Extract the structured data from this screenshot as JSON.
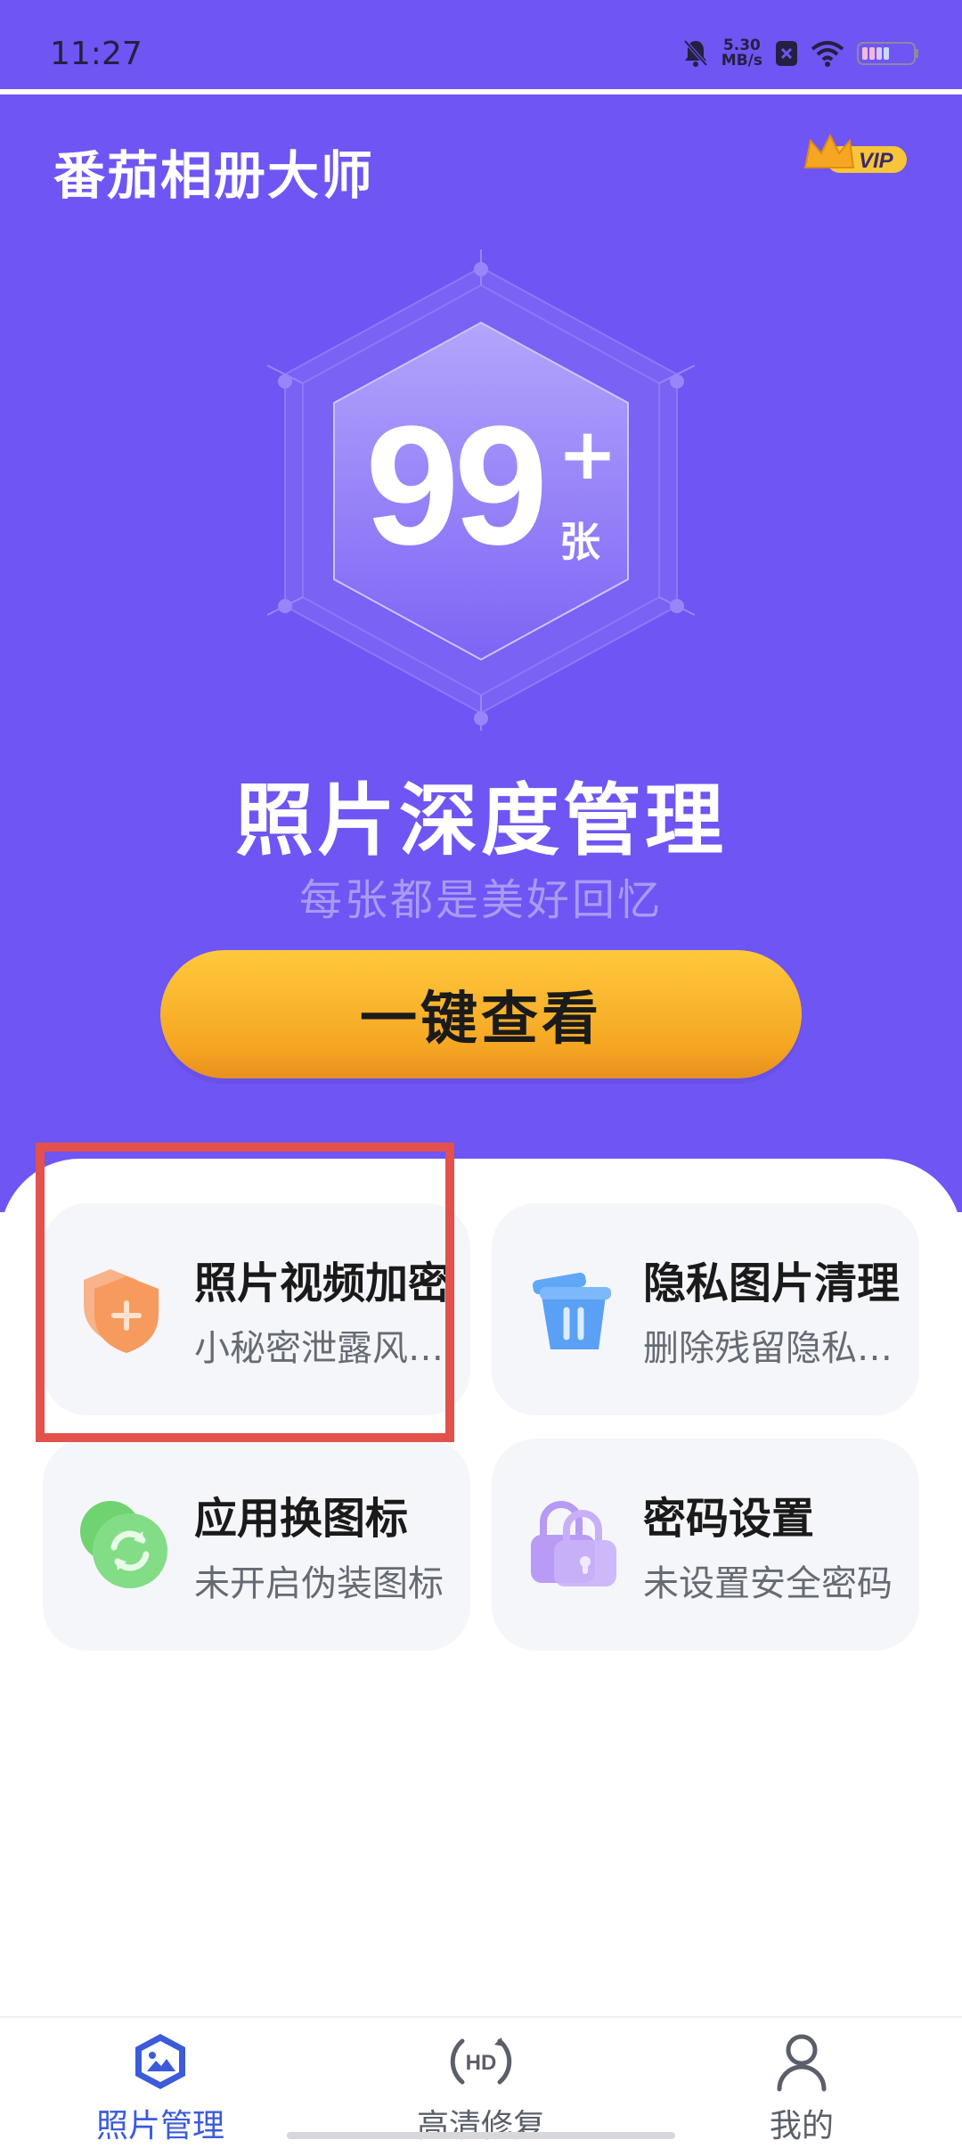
{
  "status_bar": {
    "time": "11:27",
    "net_speed_value": "5.30",
    "net_speed_unit": "MB/s"
  },
  "app": {
    "title": "番茄相册大师",
    "vip_label": "VIP"
  },
  "summary": {
    "count": "99",
    "plus": "+",
    "unit": "张"
  },
  "headline": "照片深度管理",
  "subline": "每张都是美好回忆",
  "cta_label": "一键查看",
  "features": [
    {
      "title": "照片视频加密",
      "desc": "小秘密泄露风…",
      "icon": "shield-plus-icon"
    },
    {
      "title": "隐私图片清理",
      "desc": "删除残留隐私…",
      "icon": "trash-icon"
    },
    {
      "title": "应用换图标",
      "desc": "未开启伪装图标",
      "icon": "refresh-icon"
    },
    {
      "title": "密码设置",
      "desc": "未设置安全密码",
      "icon": "lock-icon"
    }
  ],
  "nav": [
    {
      "label": "照片管理",
      "icon": "photo-manage-icon",
      "active": true
    },
    {
      "label": "高清修复",
      "icon": "hd-icon",
      "active": false
    },
    {
      "label": "我的",
      "icon": "person-icon",
      "active": false
    }
  ],
  "colors": {
    "primary": "#6f55f3",
    "accent": "#f5a623",
    "active_nav": "#3b5bdb",
    "inactive_nav": "#5a5f6a",
    "highlight": "#e2514c"
  }
}
